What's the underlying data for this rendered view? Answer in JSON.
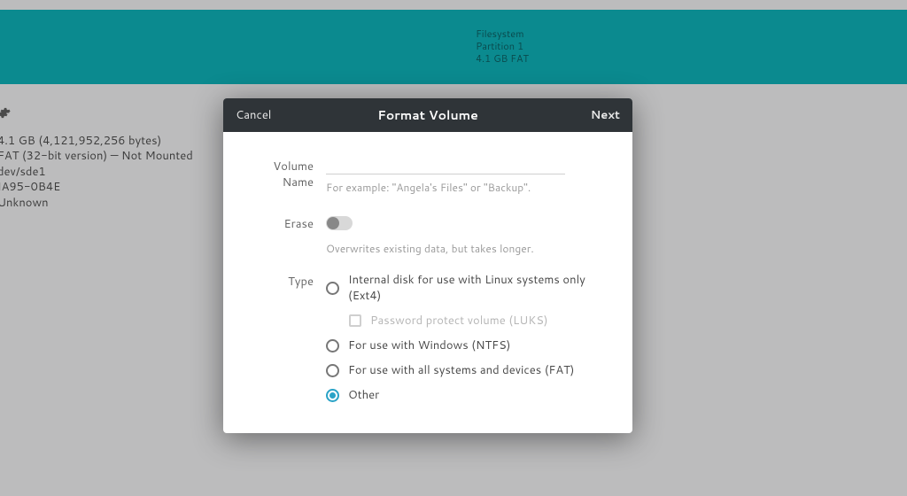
{
  "banner": {
    "line1": "Filesystem",
    "line2": "Partition 1",
    "line3": "4.1 GB FAT"
  },
  "bg_info": {
    "size": "4.1 GB (4,121,952,256 bytes)",
    "fs": "FAT (32-bit version) — Not Mounted",
    "dev": "dev/sde1",
    "uuid": "IA95-0B4E",
    "state": "Unknown"
  },
  "dialog": {
    "cancel": "Cancel",
    "title": "Format Volume",
    "next": "Next",
    "volume_name_label": "Volume Name",
    "volume_name_value": "",
    "volume_name_hint": "For example: \"Angela's Files\" or \"Backup\".",
    "erase_label": "Erase",
    "erase_on": false,
    "erase_hint": "Overwrites existing data, but takes longer.",
    "type_label": "Type",
    "type_options": {
      "ext4": "Internal disk for use with Linux systems only (Ext4)",
      "luks": "Password protect volume (LUKS)",
      "ntfs": "For use with Windows (NTFS)",
      "fat": "For use with all systems and devices (FAT)",
      "other": "Other"
    },
    "type_selected": "other"
  }
}
